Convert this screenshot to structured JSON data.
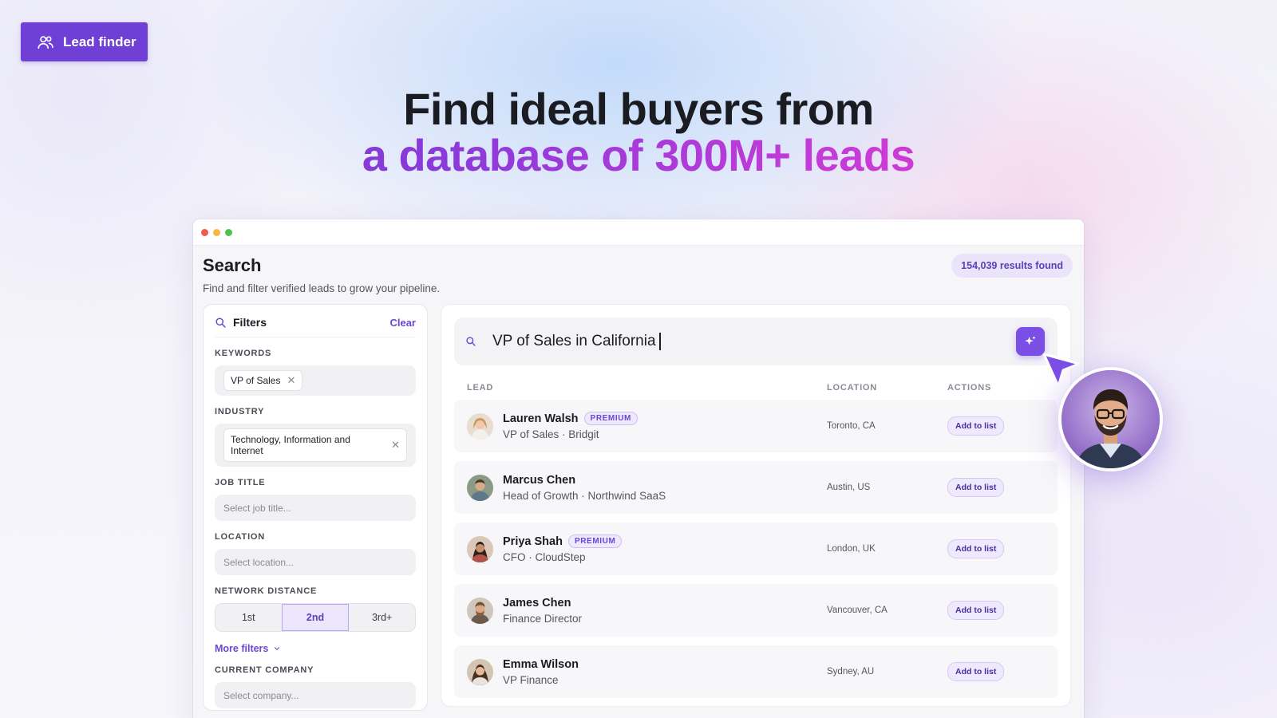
{
  "badge": {
    "label": "Lead finder",
    "icon": "users-icon"
  },
  "headline": {
    "line1": "Find ideal buyers from",
    "line2": "a database of 300M+ leads"
  },
  "window": {
    "title": "Search",
    "subtitle": "Find and filter verified leads to grow your pipeline.",
    "results_count": "154,039 results found"
  },
  "filters": {
    "title": "Filters",
    "clear_label": "Clear",
    "keywords": {
      "label": "KEYWORDS",
      "chip": "VP of Sales"
    },
    "industry": {
      "label": "INDUSTRY",
      "chip": "Technology, Information and Internet"
    },
    "job_title": {
      "label": "JOB TITLE",
      "placeholder": "Select job title..."
    },
    "location": {
      "label": "LOCATION",
      "placeholder": "Select location..."
    },
    "network": {
      "label": "NETWORK DISTANCE",
      "options": [
        "1st",
        "2nd",
        "3rd+"
      ],
      "selected": "2nd"
    },
    "more_filters": "More filters",
    "current_company": {
      "label": "CURRENT COMPANY",
      "placeholder": "Select company..."
    }
  },
  "search": {
    "query": "VP of Sales in California"
  },
  "table": {
    "headers": [
      "LEAD",
      "LOCATION",
      "ACTIONS"
    ],
    "rows": [
      {
        "name": "Lauren Walsh",
        "premium": "PREMIUM",
        "role": "VP of Sales · Bridgit",
        "location": "Toronto, CA",
        "action": "Add to list"
      },
      {
        "name": "Marcus Chen",
        "premium": "",
        "role": "Head of Growth · Northwind SaaS",
        "location": "Austin, US",
        "action": "Add to list"
      },
      {
        "name": "Priya Shah",
        "premium": "PREMIUM",
        "role": "CFO · CloudStep",
        "location": "London, UK",
        "action": "Add to list"
      },
      {
        "name": "James Chen",
        "premium": "",
        "role": "Finance Director",
        "location": "Vancouver, CA",
        "action": "Add to list"
      },
      {
        "name": "Emma Wilson",
        "premium": "",
        "role": "VP Finance",
        "location": "Sydney, AU",
        "action": "Add to list"
      }
    ]
  },
  "colors": {
    "accent": "#6f3fd6",
    "gradient_start": "#6d3fd8",
    "gradient_end": "#e93cc0"
  }
}
